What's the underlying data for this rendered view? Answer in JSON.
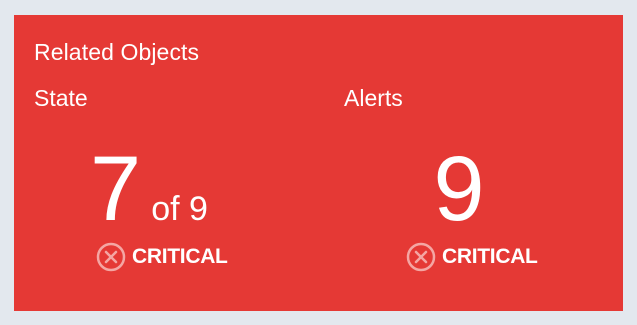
{
  "tile": {
    "title": "Related Objects",
    "background_color": "#e53935",
    "state": {
      "label": "State",
      "value": "7",
      "of_text": "of 9",
      "status": "CRITICAL",
      "status_icon": "x-circle-icon"
    },
    "alerts": {
      "label": "Alerts",
      "value": "9",
      "status": "CRITICAL",
      "status_icon": "x-circle-icon"
    }
  }
}
